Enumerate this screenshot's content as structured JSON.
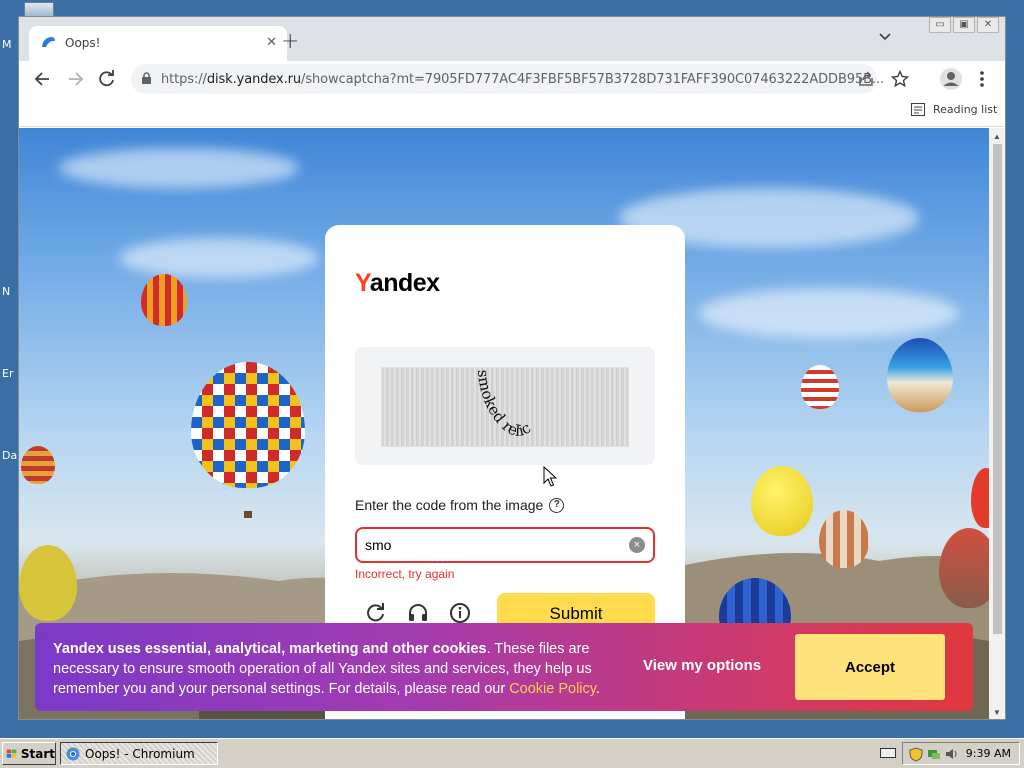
{
  "desktop": {
    "labels": [
      "M",
      "N",
      "Er",
      "Da"
    ]
  },
  "browser": {
    "tab_title": "Oops!",
    "tab_close": "✕",
    "new_tab": "+",
    "url_prefix": "https://",
    "url_host": "disk.yandex.ru",
    "url_path": "/showcaptcha?mt=7905FD777AC4F3FBF5BF57B3728D731FAFF390C07463222ADDB95B...",
    "reading_list": "Reading list",
    "window_buttons": [
      "▭",
      "▣",
      "✕"
    ]
  },
  "captcha": {
    "logo_y": "Y",
    "logo_rest": "andex",
    "image_text": "smoked relic",
    "prompt": "Enter the code from the image",
    "help": "?",
    "input_value": "smo",
    "clear": "×",
    "error": "Incorrect, try again",
    "submit": "Submit"
  },
  "cookie_banner": {
    "bold_text": "Yandex uses essential, analytical, marketing and other cookies",
    "text": ". These files are necessary to ensure smooth operation of all Yandex sites and services, they help us remember you and your personal settings. For details, please read our ",
    "link": "Cookie Policy",
    "end": ".",
    "options": "View my options",
    "accept": "Accept"
  },
  "taskbar": {
    "start": "Start",
    "task": "Oops! - Chromium",
    "clock": "9:39 AM"
  },
  "colors": {
    "yandex_red": "#fc3f1d",
    "error_red": "#e3302f",
    "submit_yellow": "#ffdb4d",
    "accept_yellow": "#ffe37a"
  }
}
